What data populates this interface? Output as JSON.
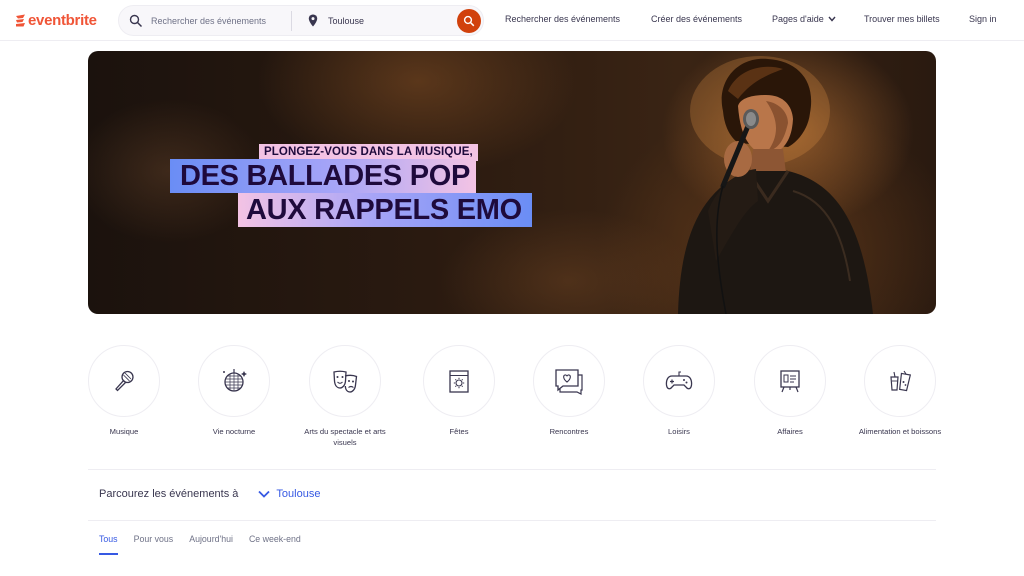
{
  "brand": {
    "name": "eventbrite",
    "color": "#f05537"
  },
  "header": {
    "search_placeholder": "Rechercher des événements",
    "location_value": "Toulouse",
    "nav": {
      "find_events": "Rechercher des événements",
      "create_events": "Créer des événements",
      "help": "Pages d'aide",
      "tickets": "Trouver mes billets",
      "sign_in": "Sign in"
    }
  },
  "hero": {
    "line_small": "PLONGEZ-VOUS DANS LA MUSIQUE,",
    "line_big1": "DES BALLADES POP",
    "line_big2": "AUX RAPPELS EMO"
  },
  "categories": [
    {
      "label": "Musique",
      "icon": "microphone-icon"
    },
    {
      "label": "Vie nocturne",
      "icon": "disco-ball-icon"
    },
    {
      "label": "Arts du spectacle et arts visuels",
      "icon": "theater-masks-icon"
    },
    {
      "label": "Fêtes",
      "icon": "calendar-sun-icon"
    },
    {
      "label": "Rencontres",
      "icon": "chat-heart-icon"
    },
    {
      "label": "Loisirs",
      "icon": "gamepad-icon"
    },
    {
      "label": "Affaires",
      "icon": "presentation-board-icon"
    },
    {
      "label": "Alimentation et boissons",
      "icon": "drink-icon"
    }
  ],
  "browse": {
    "label": "Parcourez les événements à",
    "location": "Toulouse"
  },
  "tabs": [
    "Tous",
    "Pour vous",
    "Aujourd'hui",
    "Ce week-end"
  ],
  "colors": {
    "accent": "#3659e3",
    "search_button": "#d1410c"
  }
}
